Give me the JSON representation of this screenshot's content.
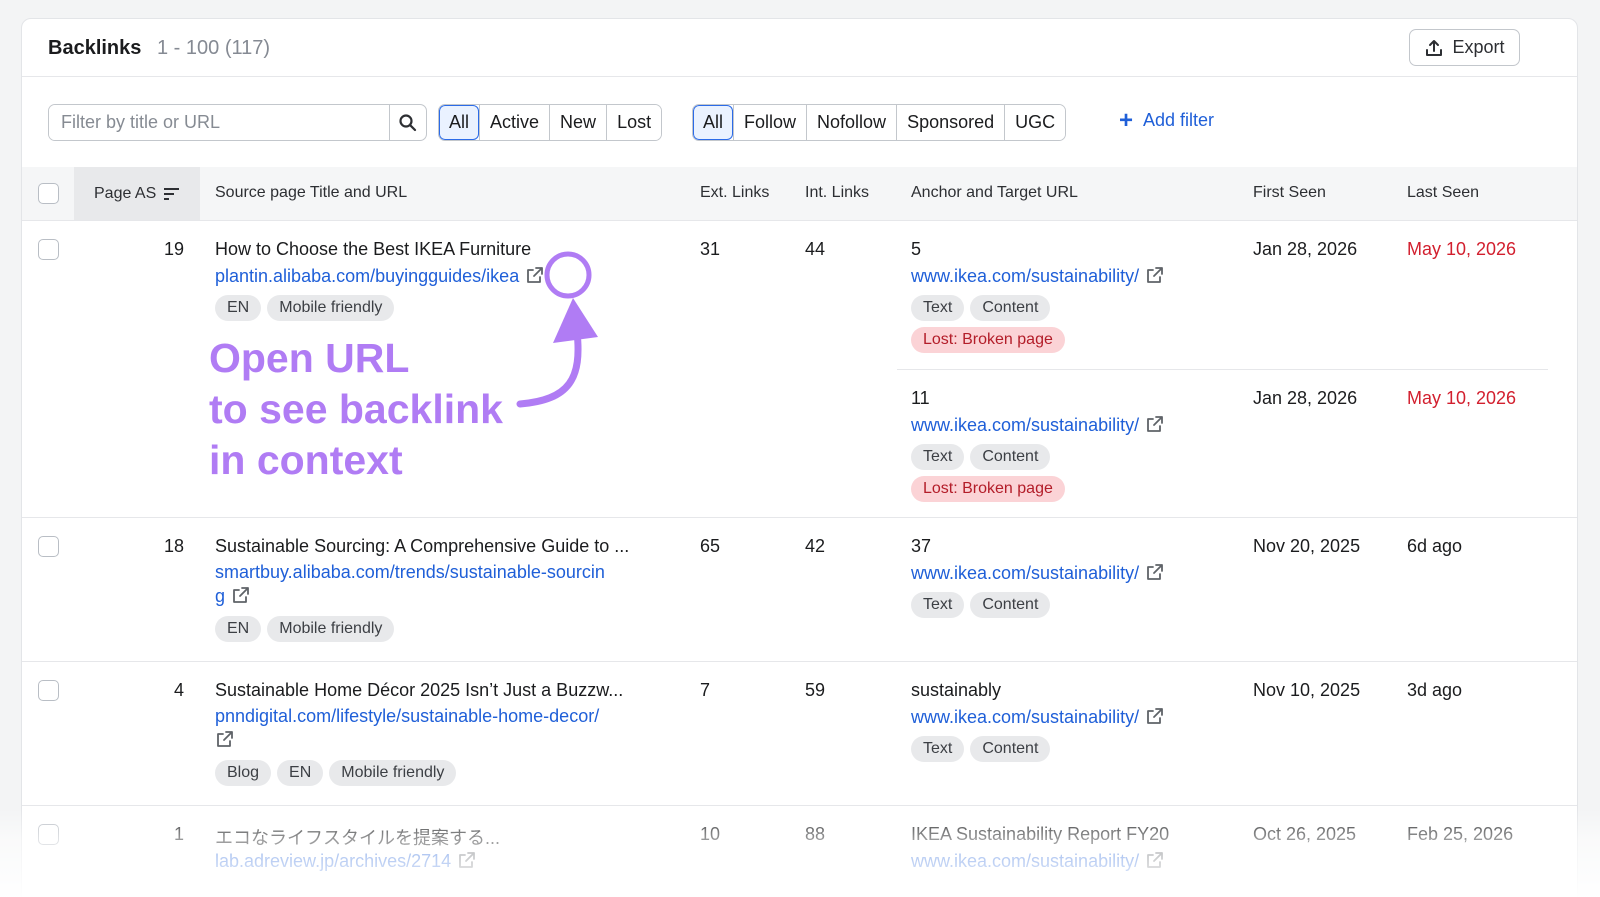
{
  "header": {
    "title": "Backlinks",
    "count": "1 - 100 (117)",
    "export_label": "Export"
  },
  "filters": {
    "search_placeholder": "Filter by title or URL",
    "link_status": [
      "All",
      "Active",
      "New",
      "Lost"
    ],
    "link_status_selected": "All",
    "link_type": [
      "All",
      "Follow",
      "Nofollow",
      "Sponsored",
      "UGC"
    ],
    "link_type_selected": "All",
    "add_filter_label": "Add filter"
  },
  "columns": {
    "page_as": "Page AS",
    "source": "Source page Title and URL",
    "ext_links": "Ext. Links",
    "int_links": "Int. Links",
    "anchor": "Anchor and Target URL",
    "first_seen": "First Seen",
    "last_seen": "Last Seen"
  },
  "rows": [
    {
      "page_as": "19",
      "title": "How to Choose the Best IKEA Furniture",
      "url": "plantin.alibaba.com/buyingguides/ikea",
      "tags": [
        "EN",
        "Mobile friendly"
      ],
      "ext_links": "31",
      "int_links": "44",
      "anchors": [
        {
          "anchor": "5",
          "target": "www.ikea.com/sustainability/",
          "tags": [
            "Text",
            "Content"
          ],
          "status": "Lost: Broken page",
          "first_seen": "Jan 28, 2026",
          "last_seen": "May 10, 2026"
        },
        {
          "anchor": "11",
          "target": "www.ikea.com/sustainability/",
          "tags": [
            "Text",
            "Content"
          ],
          "status": "Lost: Broken page",
          "first_seen": "Jan 28, 2026",
          "last_seen": "May 10, 2026"
        }
      ]
    },
    {
      "page_as": "18",
      "title": "Sustainable Sourcing: A Comprehensive Guide to ...",
      "url_line1": "smartbuy.alibaba.com/trends/sustainable-sourcin",
      "url_line2": "g",
      "tags": [
        "EN",
        "Mobile friendly"
      ],
      "ext_links": "65",
      "int_links": "42",
      "anchor": "37",
      "target": "www.ikea.com/sustainability/",
      "anchor_tags": [
        "Text",
        "Content"
      ],
      "first_seen": "Nov 20, 2025",
      "last_seen": "6d ago"
    },
    {
      "page_as": "4",
      "title": "Sustainable Home Décor 2025 Isn’t Just a Buzzw...",
      "url": "pnndigital.com/lifestyle/sustainable-home-decor/",
      "tags": [
        "Blog",
        "EN",
        "Mobile friendly"
      ],
      "ext_links": "7",
      "int_links": "59",
      "anchor": "sustainably",
      "target": "www.ikea.com/sustainability/",
      "anchor_tags": [
        "Text",
        "Content"
      ],
      "first_seen": "Nov 10, 2025",
      "last_seen": "3d ago"
    },
    {
      "page_as": "1",
      "title": "エコなライフスタイルを提案する...",
      "url": "lab.adreview.jp/archives/2714",
      "ext_links": "10",
      "int_links": "88",
      "anchor": "IKEA Sustainability Report FY20",
      "target": "www.ikea.com/sustainability/",
      "first_seen": "Oct 26, 2025",
      "last_seen": "Feb 25, 2026"
    }
  ],
  "annotation": {
    "line1": "Open URL",
    "line2": "to see backlink",
    "line3": "in context",
    "color": "#b07cf4"
  },
  "colors": {
    "link": "#1f5fd8",
    "lost_date": "#d21f2e",
    "lost_badge_bg": "#fbd3d6",
    "lost_badge_text": "#b31d29",
    "active_filter": "#2b6be8"
  }
}
